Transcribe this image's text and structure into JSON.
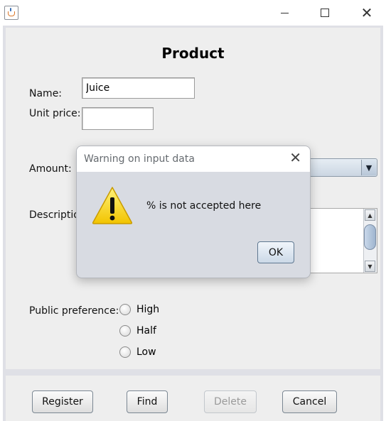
{
  "window": {
    "minimize_glyph": "",
    "close_glyph": "✕"
  },
  "form": {
    "title": "Product",
    "name_label": "Name:",
    "name_value": "Juice",
    "unit_price_label": "Unit price:",
    "unit_price_value": "",
    "amount_label": "Amount:",
    "amount_arrow": "▼",
    "description_label": "Descriptio",
    "preference_label": "Public preference:",
    "preference_options": [
      "High",
      "Half",
      "Low"
    ]
  },
  "buttons": {
    "register": "Register",
    "find": "Find",
    "delete": "Delete",
    "cancel": "Cancel"
  },
  "dialog": {
    "title": "Warning on input data",
    "close_glyph": "✕",
    "message": "% is not accepted here",
    "ok": "OK"
  },
  "colors": {
    "client_bg": "#dfe0e6",
    "panel_bg": "#eeeeee",
    "dialog_bg": "#d8dbe2",
    "warning_yellow": "#f5d10b"
  }
}
